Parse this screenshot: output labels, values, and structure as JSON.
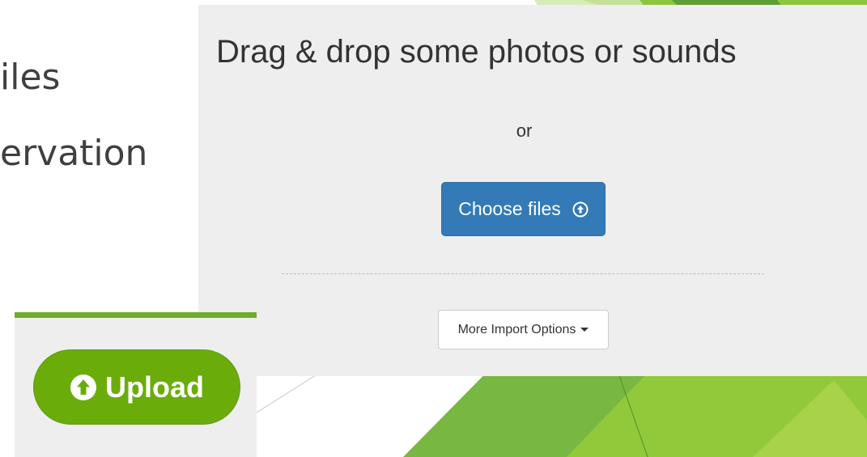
{
  "slide": {
    "text_lines": [
      "iles",
      "ervation"
    ]
  },
  "uploader": {
    "title": "Drag & drop some photos or sounds",
    "or_text": "or",
    "choose_files_label": "Choose files",
    "more_import_options_label": "More Import Options"
  },
  "upload_inset": {
    "upload_button_label": "Upload"
  },
  "colors": {
    "primary_blue": "#337ab7",
    "upload_green": "#6aad0b",
    "panel_gray": "#eeeeee",
    "slide_green_light": "#8dc63f",
    "slide_green_dark": "#5b9b36"
  },
  "icons": {
    "choose_files": "circle-arrow-up-icon",
    "more_options": "caret-down-icon",
    "upload": "circle-arrow-up-icon"
  }
}
